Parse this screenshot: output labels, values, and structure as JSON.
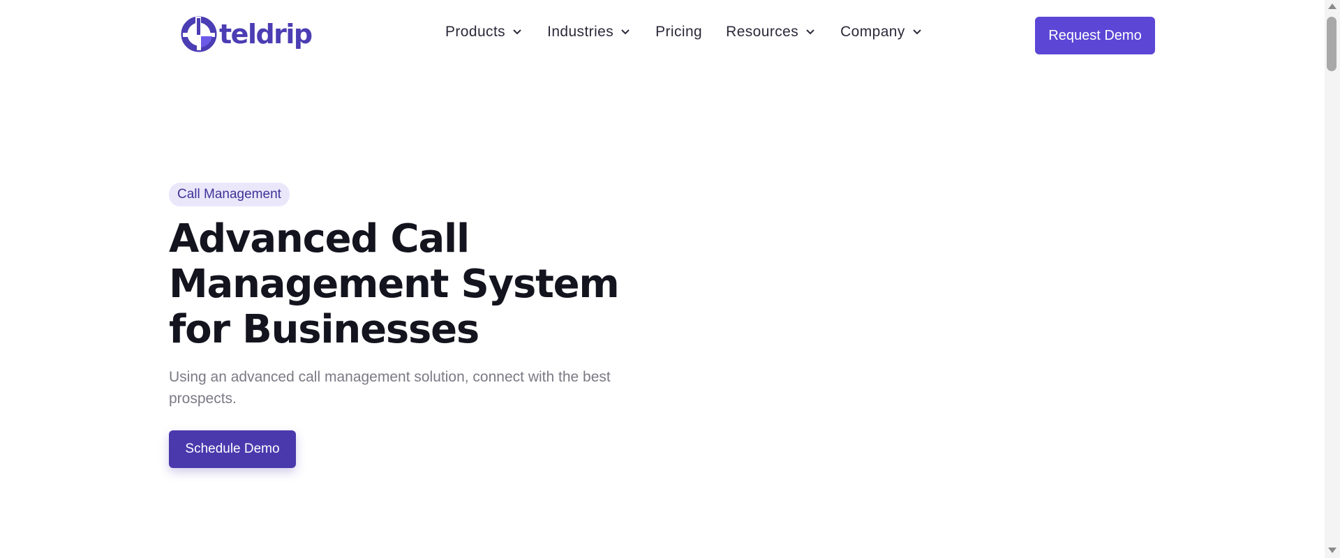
{
  "brand": {
    "name": "teldrip",
    "color": "#4b3db3"
  },
  "nav": {
    "items": [
      {
        "label": "Products",
        "has_dropdown": true,
        "icon": "chevron-down-icon"
      },
      {
        "label": "Industries",
        "has_dropdown": true,
        "icon": "chevron-down-icon"
      },
      {
        "label": "Pricing",
        "has_dropdown": false
      },
      {
        "label": "Resources",
        "has_dropdown": true,
        "icon": "chevron-down-icon"
      },
      {
        "label": "Company",
        "has_dropdown": true,
        "icon": "chevron-down-icon"
      }
    ]
  },
  "header": {
    "cta_label": "Request Demo",
    "cta_color": "#5b46d6"
  },
  "hero": {
    "badge": "Call Management",
    "title": "Advanced Call Management System for Businesses",
    "subtitle": "Using an advanced call management solution, connect with the best prospects.",
    "cta_label": "Schedule Demo",
    "cta_color": "#4a38ad",
    "badge_bg": "#ebe7fb"
  }
}
